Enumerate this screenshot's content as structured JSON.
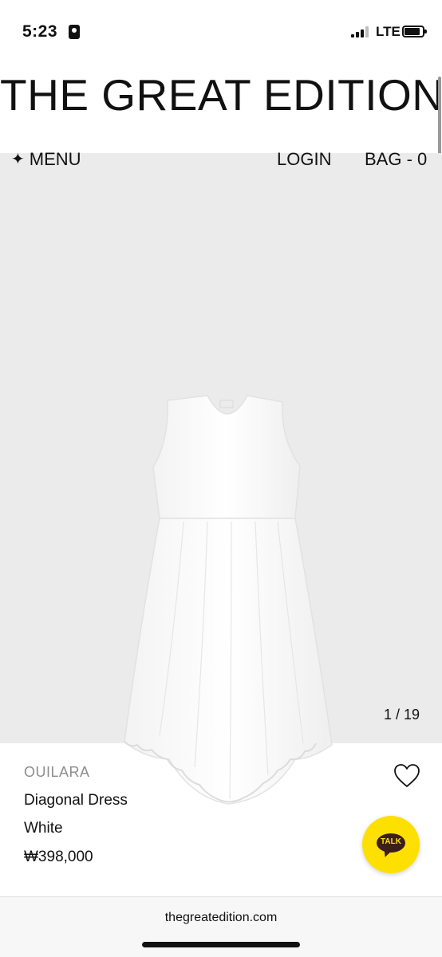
{
  "status_bar": {
    "time": "5:23",
    "network": "LTE"
  },
  "header": {
    "brand_title": "THE GREAT EDITION"
  },
  "nav": {
    "menu_label": "MENU",
    "menu_icon": "sparkle-icon",
    "login_label": "LOGIN",
    "bag_label": "BAG - 0"
  },
  "gallery": {
    "counter": "1 / 19"
  },
  "product": {
    "brand": "OUILARA",
    "name": "Diagonal Dress",
    "color": "White",
    "price": "₩398,000",
    "wishlist_icon": "heart-outline-icon"
  },
  "chat": {
    "label": "TALK",
    "accent_color": "#fde000"
  },
  "browser": {
    "url": "thegreatedition.com"
  }
}
